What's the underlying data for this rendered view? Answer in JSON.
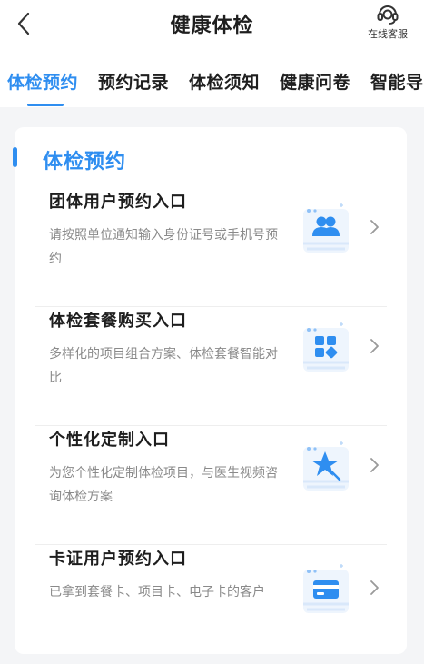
{
  "header": {
    "title": "健康体检",
    "service_label": "在线客服"
  },
  "tabs": [
    {
      "label": "体检预约",
      "active": true
    },
    {
      "label": "预约记录",
      "active": false
    },
    {
      "label": "体检须知",
      "active": false
    },
    {
      "label": "健康问卷",
      "active": false
    },
    {
      "label": "智能导",
      "active": false
    }
  ],
  "section": {
    "title": "体检预约",
    "entries": [
      {
        "title": "团体用户预约入口",
        "desc": "请按照单位通知输入身份证号或手机号预约",
        "icon": "group-users-icon"
      },
      {
        "title": "体检套餐购买入口",
        "desc": "多样化的项目组合方案、体检套餐智能对比",
        "icon": "package-grid-icon"
      },
      {
        "title": "个性化定制入口",
        "desc": "为您个性化定制体检项目，与医生视频咨询体检方案",
        "icon": "star-customize-icon"
      },
      {
        "title": "卡证用户预约入口",
        "desc": "已拿到套餐卡、项目卡、电子卡的客户",
        "icon": "card-icon"
      }
    ]
  },
  "colors": {
    "accent": "#2f8ef0",
    "background": "#f4f5f7"
  }
}
